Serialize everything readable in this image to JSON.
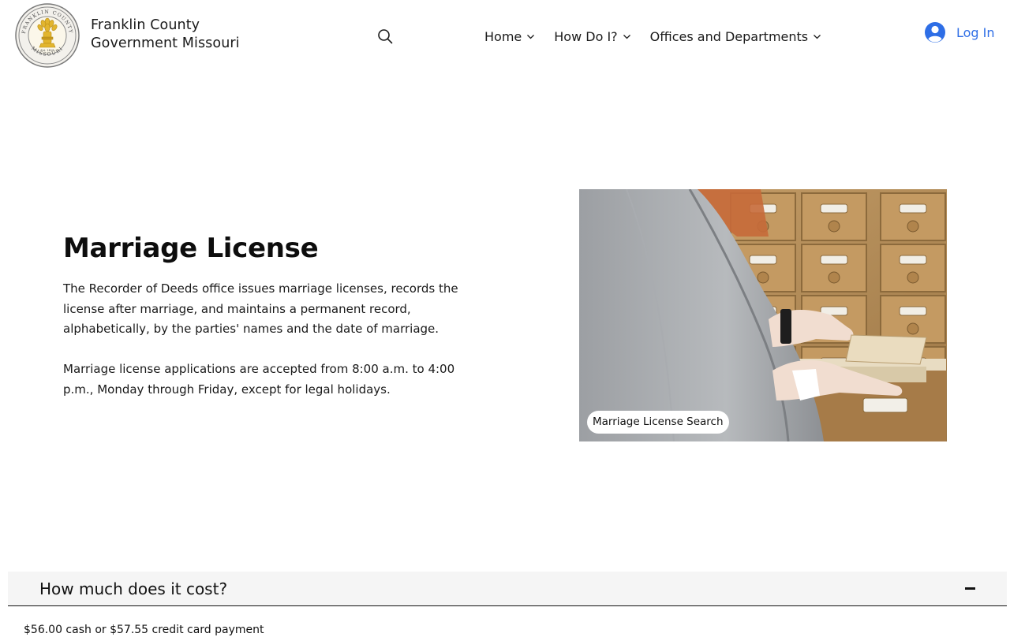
{
  "header": {
    "site_name_line1": "Franklin County",
    "site_name_line2": "Government Missouri",
    "seal_text_top": "FRANKLIN COUNTY",
    "seal_text_bottom": "MISSOURI",
    "seal_year": "Est. 1818",
    "nav": [
      {
        "label": "Home"
      },
      {
        "label": "How Do I?"
      },
      {
        "label": "Offices and Departments"
      }
    ],
    "login_label": "Log In",
    "accent_color": "#2e6ee6"
  },
  "hero": {
    "title": "Marriage License",
    "paragraph1": "The Recorder of Deeds office issues marriage licenses, records the license after marriage, and maintains a permanent record, alphabetically, by the parties' names and the date of marriage.",
    "paragraph2": "Marriage license applications are accepted from 8:00 a.m. to 4:00 p.m., Monday through Friday, except for legal holidays.",
    "image_link_label": "Marriage License Search"
  },
  "accordion": {
    "title": "How much does it cost?",
    "body": "$56.00 cash or $57.55 credit card payment"
  },
  "icons": {
    "search": "search-icon",
    "chevron": "chevron-down-icon",
    "account": "account-icon",
    "collapse": "minus-icon"
  }
}
